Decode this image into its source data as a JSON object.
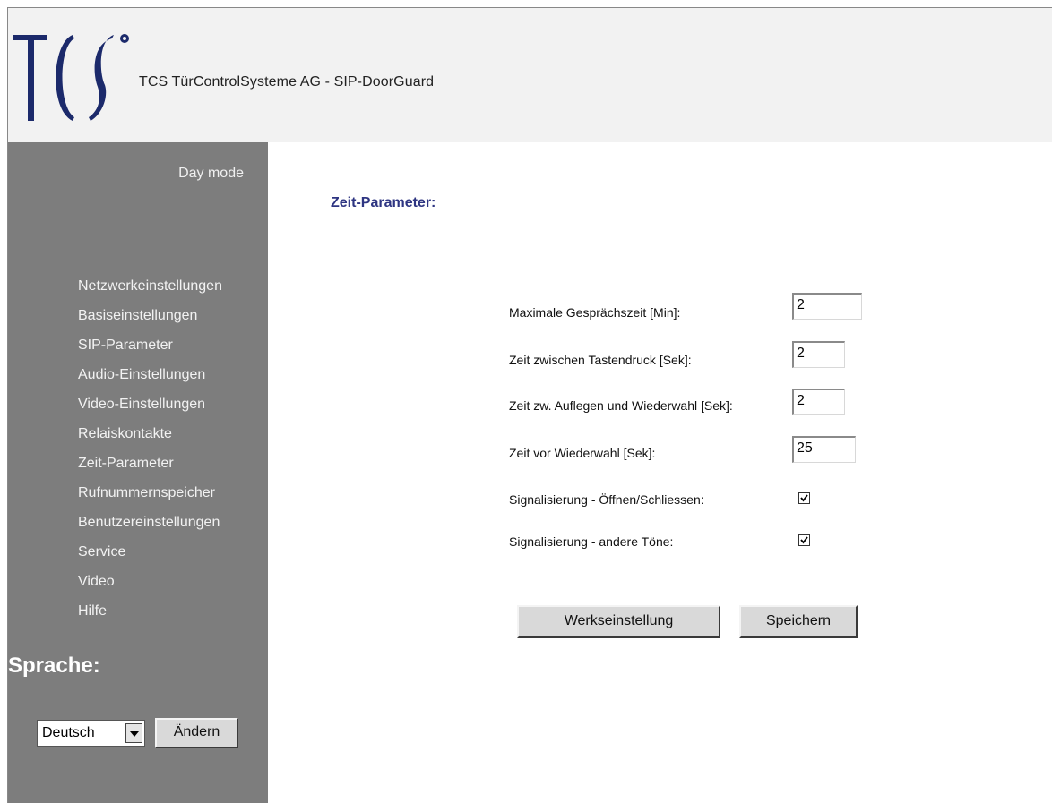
{
  "header": {
    "logo_text": "TCS",
    "title": "TCS TürControlSysteme AG - SIP-DoorGuard"
  },
  "sidebar": {
    "mode": "Day mode",
    "nav_items": [
      "Netzwerkeinstellungen",
      "Basiseinstellungen",
      "SIP-Parameter",
      "Audio-Einstellungen",
      "Video-Einstellungen",
      "Relaiskontakte",
      "Zeit-Parameter",
      "Rufnummernspeicher",
      "Benutzereinstellungen",
      "Service",
      "Video",
      "Hilfe"
    ],
    "language_heading": "Sprache:",
    "language_selected": "Deutsch",
    "change_button": "Ändern"
  },
  "main": {
    "section_title": "Zeit-Parameter:",
    "params": [
      {
        "label": "Maximale Gesprächszeit [Min]:",
        "value": "2"
      },
      {
        "label": "Zeit zwischen Tastendruck [Sek]:",
        "value": "2"
      },
      {
        "label": "Zeit zw. Auflegen und Wiederwahl [Sek]:",
        "value": "2"
      },
      {
        "label": "Zeit vor Wiederwahl [Sek]:",
        "value": "25"
      }
    ],
    "toggles": [
      {
        "label": "Signalisierung - Öffnen/Schliessen:",
        "checked": true
      },
      {
        "label": "Signalisierung - andere Töne:",
        "checked": true
      }
    ],
    "factory_button": "Werkseinstellung",
    "save_button": "Speichern"
  },
  "colors": {
    "header_bg": "#f2f2f2",
    "sidebar_bg": "#7d7d7d",
    "section_title": "#2e3582",
    "logo": "#1c2a6b"
  }
}
